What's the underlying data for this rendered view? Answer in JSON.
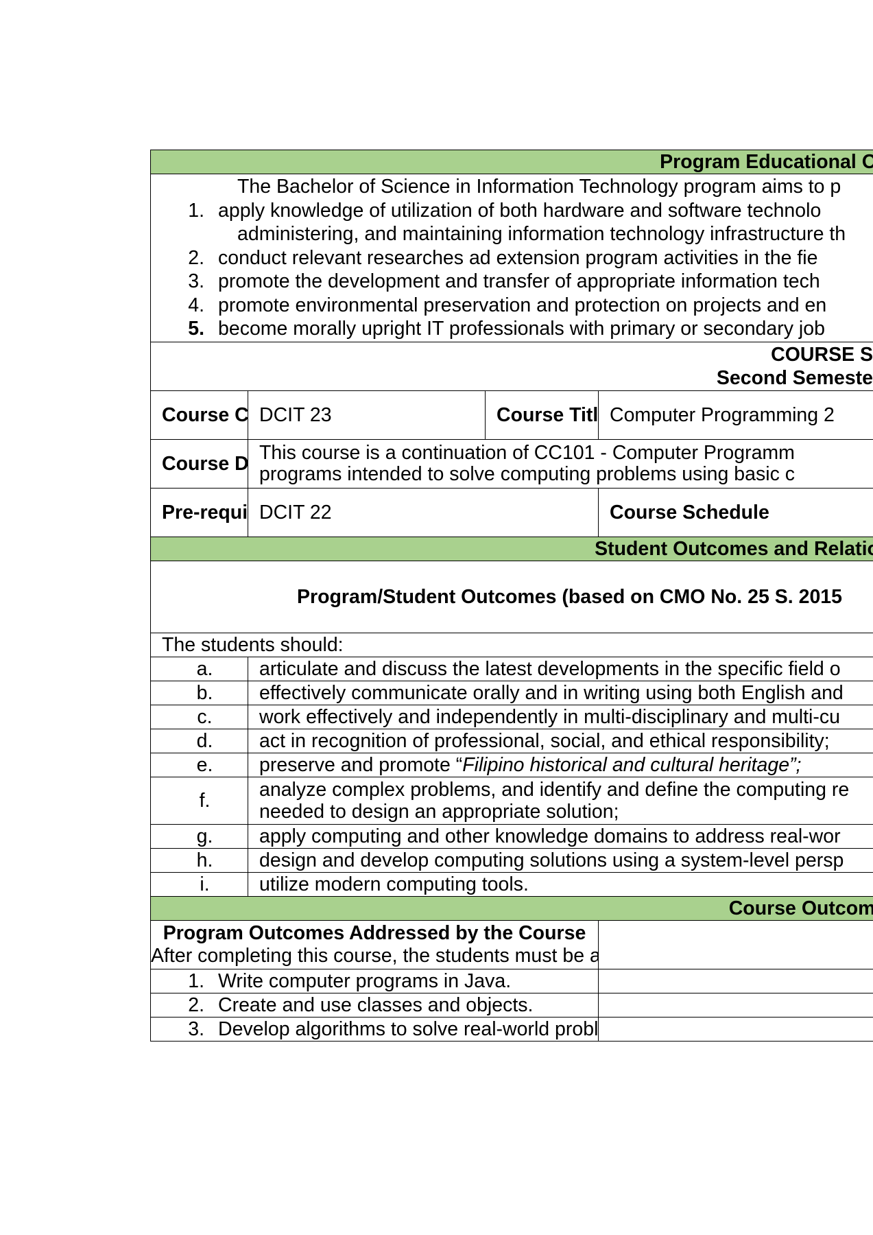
{
  "peo": {
    "header": "Program Educational Objectives",
    "intro": "The Bachelor of Science in Information Technology program aims to p",
    "items": [
      {
        "num": "1.",
        "line1": "apply knowledge of utilization of both hardware and software technolo",
        "line2": "administering, and maintaining information technology infrastructure th"
      },
      {
        "num": "2.",
        "line1": "conduct relevant researches ad extension program activities in the fie"
      },
      {
        "num": "3.",
        "line1": "promote the development and transfer of appropriate information tech"
      },
      {
        "num": "4.",
        "line1": "promote environmental preservation and protection on projects and en"
      },
      {
        "num": "5.",
        "line1": "become morally upright IT professionals with primary or secondary job"
      }
    ]
  },
  "syllabus": {
    "title": "COURSE S",
    "semester": "Second Semeste"
  },
  "course": {
    "code_label": "Course Code",
    "code": "DCIT 23",
    "title_label": "Course Title",
    "title": "Computer Programming 2",
    "desc_label": "Course Description",
    "desc_line1": "This course is a continuation of CC101 - Computer Programm",
    "desc_line2": "programs intended to solve computing problems using basic c",
    "prereq_label": "Pre-requisites",
    "prereq": "DCIT 22",
    "schedule_label": "Course Schedule"
  },
  "student_outcomes": {
    "header": "Student Outcomes and Relationship",
    "subheader": "Program/Student Outcomes (based on CMO No. 25 S. 2015",
    "lead": "The students should:",
    "items": [
      {
        "letter": "a.",
        "text": "articulate and discuss the latest developments in the specific field o"
      },
      {
        "letter": "b.",
        "text": "effectively communicate orally and in writing using both English and"
      },
      {
        "letter": "c.",
        "text": "work effectively and independently in multi-disciplinary and multi-cu"
      },
      {
        "letter": "d.",
        "text": "act in recognition of professional, social, and ethical responsibility;"
      },
      {
        "letter": "e.",
        "text_pre": "preserve and promote “",
        "text_italic": "Filipino historical and cultural heritage”;"
      },
      {
        "letter": "f.",
        "text": "analyze complex problems, and identify and define the computing re",
        "text2": "needed to design an appropriate solution;"
      },
      {
        "letter": "g.",
        "text": "apply computing and other knowledge domains to address real-wor"
      },
      {
        "letter": "h.",
        "text": "design and develop computing solutions using a system-level persp"
      },
      {
        "letter": "i.",
        "text": "utilize modern computing tools."
      }
    ]
  },
  "course_outcomes": {
    "header": "Course Outcomes and Relati",
    "subheader": "Program Outcomes Addressed by the Course",
    "lead": "After completing this course, the students must be able to:",
    "items": [
      {
        "num": "1.",
        "text": "Write computer programs in Java."
      },
      {
        "num": "2.",
        "text": "Create and use classes and objects."
      },
      {
        "num": "3.",
        "text": "Develop algorithms to solve real-world problems"
      }
    ]
  }
}
